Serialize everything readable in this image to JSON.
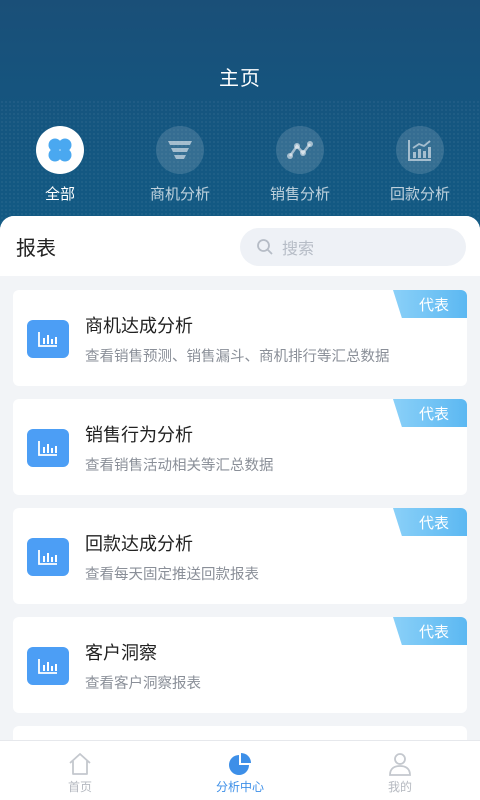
{
  "header": {
    "title": "主页"
  },
  "categories": [
    {
      "label": "全部",
      "icon": "clover-icon",
      "active": true
    },
    {
      "label": "商机分析",
      "icon": "funnel-icon",
      "active": false
    },
    {
      "label": "销售分析",
      "icon": "trend-icon",
      "active": false
    },
    {
      "label": "回款分析",
      "icon": "bar-chart-up-icon",
      "active": false
    }
  ],
  "section": {
    "title": "报表"
  },
  "search": {
    "placeholder": "搜索"
  },
  "reports": [
    {
      "title": "商机达成分析",
      "desc": "查看销售预测、销售漏斗、商机排行等汇总数据",
      "tag": "代表"
    },
    {
      "title": "销售行为分析",
      "desc": "查看销售活动相关等汇总数据",
      "tag": "代表"
    },
    {
      "title": "回款达成分析",
      "desc": "查看每天固定推送回款报表",
      "tag": "代表"
    },
    {
      "title": "客户洞察",
      "desc": "查看客户洞察报表",
      "tag": "代表"
    }
  ],
  "tabbar": [
    {
      "label": "首页",
      "icon": "home-icon",
      "active": false
    },
    {
      "label": "分析中心",
      "icon": "pie-chart-icon",
      "active": true
    },
    {
      "label": "我的",
      "icon": "user-icon",
      "active": false
    }
  ],
  "colors": {
    "header": "#15557f",
    "accent": "#3d8fe8",
    "tag": "#5cb8f2",
    "report_icon": "#4c9ef5"
  }
}
